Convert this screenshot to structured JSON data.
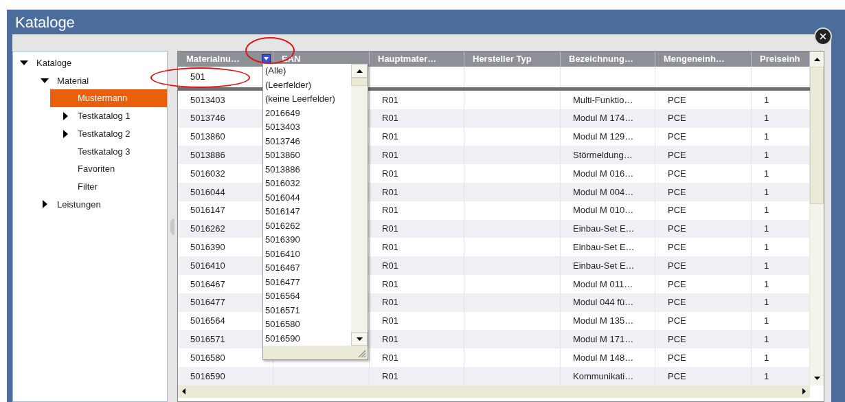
{
  "window": {
    "title": "Kataloge"
  },
  "tree": [
    {
      "label": "Kataloge",
      "expanded": true,
      "selected": false,
      "children": [
        {
          "label": "Material",
          "expanded": true,
          "selected": false,
          "children": [
            {
              "label": "Mustermann",
              "selected": true
            },
            {
              "label": "Testkatalog 1",
              "expanded": false,
              "selected": false
            },
            {
              "label": "Testkatalog 2",
              "expanded": false,
              "selected": false
            },
            {
              "label": "Testkatalog 3",
              "selected": false
            },
            {
              "label": "Favoriten",
              "selected": false
            },
            {
              "label": "Filter",
              "selected": false
            }
          ]
        },
        {
          "label": "Leistungen",
          "expanded": false,
          "selected": false
        }
      ]
    }
  ],
  "table": {
    "columns": [
      {
        "label": "Materialnu…",
        "filter_active": true
      },
      {
        "label": "EAN",
        "filter_active": false
      },
      {
        "label": "Hauptmater…",
        "filter_active": false
      },
      {
        "label": "Hersteller Typ",
        "filter_active": false
      },
      {
        "label": "Bezeichnung…",
        "filter_active": false
      },
      {
        "label": "Mengeneinh…",
        "filter_active": false
      },
      {
        "label": "Preiseinh",
        "filter_active": false
      }
    ],
    "filter_value": "501",
    "rows": [
      [
        "5013403",
        "",
        "R01",
        "",
        "Multi-Funktio…",
        "PCE",
        "1"
      ],
      [
        "5013746",
        "",
        "R01",
        "",
        "Modul M 174…",
        "PCE",
        "1"
      ],
      [
        "5013860",
        "",
        "R01",
        "",
        "Modul M 129…",
        "PCE",
        "1"
      ],
      [
        "5013886",
        "",
        "R01",
        "",
        "Störmeldung…",
        "PCE",
        "1"
      ],
      [
        "5016032",
        "",
        "R01",
        "",
        "Modul M 016…",
        "PCE",
        "1"
      ],
      [
        "5016044",
        "",
        "R01",
        "",
        "Modul M 004…",
        "PCE",
        "1"
      ],
      [
        "5016147",
        "",
        "R01",
        "",
        "Modul M 010…",
        "PCE",
        "1"
      ],
      [
        "5016262",
        "",
        "R01",
        "",
        "Einbau-Set E…",
        "PCE",
        "1"
      ],
      [
        "5016390",
        "",
        "R01",
        "",
        "Einbau-Set E…",
        "PCE",
        "1"
      ],
      [
        "5016410",
        "",
        "R01",
        "",
        "Einbau-Set E…",
        "PCE",
        "1"
      ],
      [
        "5016467",
        "",
        "R01",
        "",
        "Modul M 011…",
        "PCE",
        "1"
      ],
      [
        "5016477",
        "",
        "R01",
        "",
        "Modul 044 fü…",
        "PCE",
        "1"
      ],
      [
        "5016564",
        "",
        "R01",
        "",
        "Modul M 135…",
        "PCE",
        "1"
      ],
      [
        "5016571",
        "",
        "R01",
        "",
        "Modul M 171…",
        "PCE",
        "1"
      ],
      [
        "5016580",
        "",
        "R01",
        "",
        "Modul M 148…",
        "PCE",
        "1"
      ],
      [
        "5016590",
        "",
        "R01",
        "",
        "Kommunikati…",
        "PCE",
        "1"
      ]
    ]
  },
  "filter_dropdown": {
    "items": [
      "(Alle)",
      "(Leerfelder)",
      "(keine Leerfelder)",
      "2016649",
      "5013403",
      "5013746",
      "5013860",
      "5013886",
      "5016032",
      "5016044",
      "5016147",
      "5016262",
      "5016390",
      "5016410",
      "5016467",
      "5016477",
      "5016564",
      "5016571",
      "5016580",
      "5016590"
    ]
  }
}
